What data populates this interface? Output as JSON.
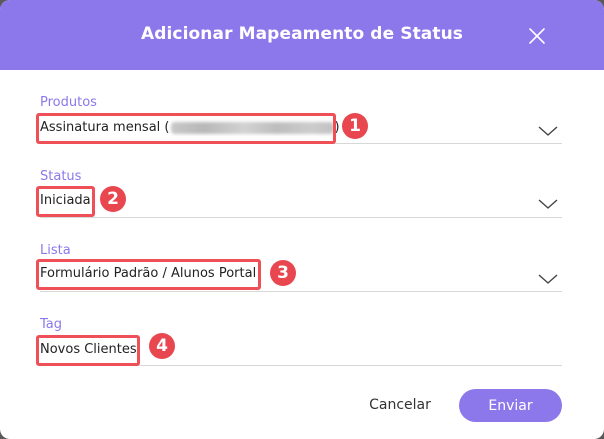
{
  "dialog": {
    "title": "Adicionar Mapeamento de Status"
  },
  "fields": {
    "produtos": {
      "label": "Produtos",
      "value_prefix": "Assinatura mensal (",
      "value_suffix": ")"
    },
    "status": {
      "label": "Status",
      "value": "Iniciada"
    },
    "lista": {
      "label": "Lista",
      "value": "Formulário Padrão / Alunos Portal"
    },
    "tag": {
      "label": "Tag",
      "value": "Novos Clientes"
    }
  },
  "badges": [
    "1",
    "2",
    "3",
    "4"
  ],
  "footer": {
    "cancel_label": "Cancelar",
    "submit_label": "Enviar"
  },
  "colors": {
    "accent": "#8c78ea",
    "highlight": "#ef4f57",
    "badge": "#e8474f"
  },
  "icons": {
    "close": "close-icon",
    "chevron": "chevron-down-icon"
  }
}
